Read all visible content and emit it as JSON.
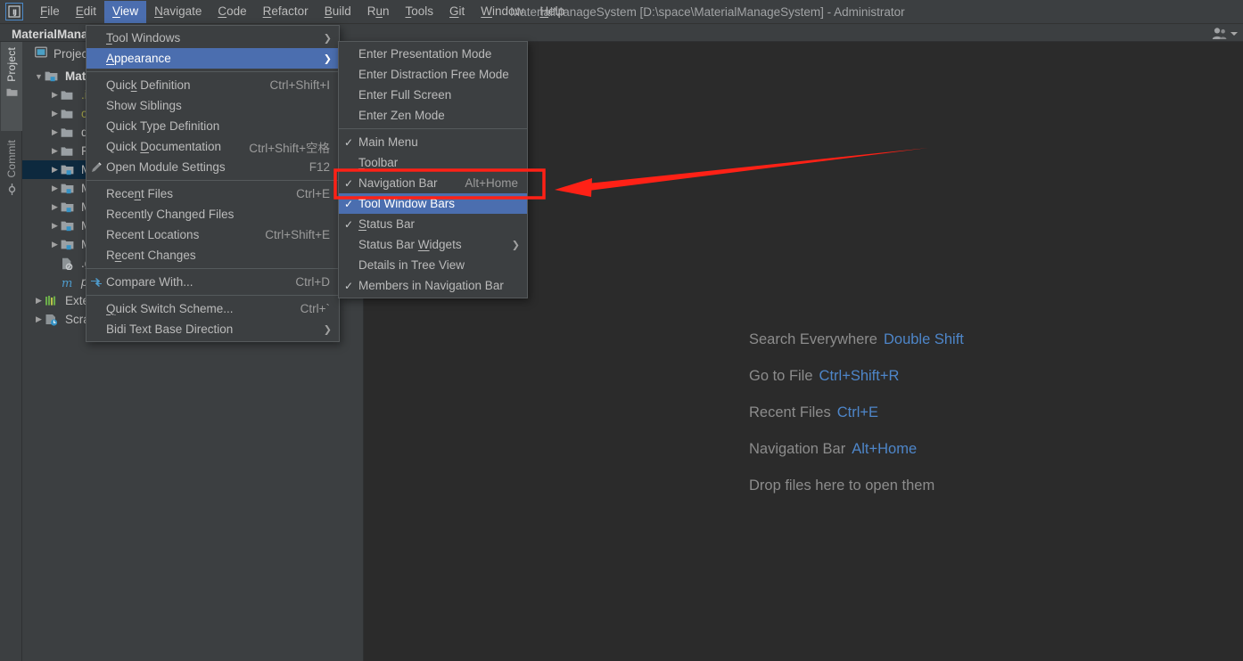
{
  "window": {
    "title": "MaterialManageSystem [D:\\space\\MaterialManageSystem] - Administrator",
    "logo_text": "IJ"
  },
  "menubar": {
    "items": [
      {
        "label": "File",
        "mnemonic": "F",
        "active": false
      },
      {
        "label": "Edit",
        "mnemonic": "E",
        "active": false
      },
      {
        "label": "View",
        "mnemonic": "V",
        "active": true
      },
      {
        "label": "Navigate",
        "mnemonic": "N",
        "active": false
      },
      {
        "label": "Code",
        "mnemonic": "C",
        "active": false
      },
      {
        "label": "Refactor",
        "mnemonic": "R",
        "active": false
      },
      {
        "label": "Build",
        "mnemonic": "B",
        "active": false
      },
      {
        "label": "Run",
        "mnemonic": "u",
        "active": false
      },
      {
        "label": "Tools",
        "mnemonic": "T",
        "active": false
      },
      {
        "label": "Git",
        "mnemonic": "G",
        "active": false
      },
      {
        "label": "Window",
        "mnemonic": "W",
        "active": false
      },
      {
        "label": "Help",
        "mnemonic": "H",
        "active": false
      }
    ]
  },
  "navbar": {
    "project_label": "MaterialMana",
    "avatar_icon": "user-account-icon",
    "avatar_caret_icon": "chevron-down-icon"
  },
  "tool_window_bar": {
    "buttons": [
      {
        "label": "Project",
        "icon": "folder-icon",
        "selected": true
      },
      {
        "label": "Commit",
        "icon": "commit-icon",
        "selected": false
      }
    ]
  },
  "project_pane": {
    "header": "Project",
    "header_icon": "project-view-icon",
    "tree": [
      {
        "indent": 0,
        "arrow": "down",
        "icon": "module-folder-icon",
        "label": "Mate",
        "style": "bold",
        "selected": false
      },
      {
        "indent": 1,
        "arrow": "right",
        "icon": "folder-icon",
        "label": ".id",
        "style": "yellowish",
        "selected": false
      },
      {
        "indent": 1,
        "arrow": "right",
        "icon": "folder-icon",
        "label": "ca",
        "style": "yellowish",
        "selected": false
      },
      {
        "indent": 1,
        "arrow": "right",
        "icon": "folder-icon",
        "label": "do",
        "style": "normal",
        "selected": false
      },
      {
        "indent": 1,
        "arrow": "right",
        "icon": "folder-icon",
        "label": "Fr",
        "style": "normal",
        "selected": false
      },
      {
        "indent": 1,
        "arrow": "right",
        "icon": "module-folder-icon",
        "label": "M",
        "style": "normal",
        "selected": true
      },
      {
        "indent": 1,
        "arrow": "right",
        "icon": "module-folder-icon",
        "label": "M",
        "style": "normal",
        "selected": false
      },
      {
        "indent": 1,
        "arrow": "right",
        "icon": "module-folder-icon",
        "label": "M",
        "style": "normal",
        "selected": false
      },
      {
        "indent": 1,
        "arrow": "right",
        "icon": "module-folder-icon",
        "label": "M",
        "style": "normal",
        "selected": false
      },
      {
        "indent": 1,
        "arrow": "right",
        "icon": "module-folder-icon",
        "label": "M",
        "style": "normal",
        "selected": false
      },
      {
        "indent": 1,
        "arrow": "none",
        "icon": "gitignore-file-icon",
        "label": ".g",
        "style": "normal",
        "selected": false
      },
      {
        "indent": 1,
        "arrow": "none",
        "icon": "maven-pom-icon",
        "label": "po",
        "style": "italic",
        "selected": false
      },
      {
        "indent": 0,
        "arrow": "right",
        "icon": "libraries-icon",
        "label": "Exter",
        "style": "normal",
        "selected": false
      },
      {
        "indent": 0,
        "arrow": "right",
        "icon": "scratches-icon",
        "label": "Scratches and Consoles",
        "style": "normal",
        "selected": false
      }
    ]
  },
  "view_menu": {
    "items": [
      {
        "label": "Tool Windows",
        "mnemonic": "T",
        "shortcut": "",
        "submenu": true,
        "check": false,
        "icon": "",
        "highlight": false
      },
      {
        "label": "Appearance",
        "mnemonic": "A",
        "shortcut": "",
        "submenu": true,
        "check": false,
        "icon": "",
        "highlight": true
      },
      {
        "separator": true
      },
      {
        "label": "Quick Definition",
        "mnemonic": "k",
        "shortcut": "Ctrl+Shift+I",
        "submenu": false,
        "check": false,
        "icon": "",
        "highlight": false
      },
      {
        "label": "Show Siblings",
        "mnemonic": "",
        "shortcut": "",
        "submenu": false,
        "check": false,
        "icon": "",
        "highlight": false
      },
      {
        "label": "Quick Type Definition",
        "mnemonic": "",
        "shortcut": "",
        "submenu": false,
        "check": false,
        "icon": "",
        "highlight": false
      },
      {
        "label": "Quick Documentation",
        "mnemonic": "D",
        "shortcut": "Ctrl+Shift+空格",
        "submenu": false,
        "check": false,
        "icon": "",
        "highlight": false
      },
      {
        "label": "Open Module Settings",
        "mnemonic": "",
        "shortcut": "F12",
        "submenu": false,
        "check": false,
        "icon": "pencil-icon",
        "highlight": false
      },
      {
        "separator": true
      },
      {
        "label": "Recent Files",
        "mnemonic": "n",
        "shortcut": "Ctrl+E",
        "submenu": false,
        "check": false,
        "icon": "",
        "highlight": false
      },
      {
        "label": "Recently Changed Files",
        "mnemonic": "",
        "shortcut": "",
        "submenu": false,
        "check": false,
        "icon": "",
        "highlight": false
      },
      {
        "label": "Recent Locations",
        "mnemonic": "",
        "shortcut": "Ctrl+Shift+E",
        "submenu": false,
        "check": false,
        "icon": "",
        "highlight": false
      },
      {
        "label": "Recent Changes",
        "mnemonic": "e",
        "shortcut": "",
        "submenu": false,
        "check": false,
        "icon": "",
        "highlight": false
      },
      {
        "separator": true
      },
      {
        "label": "Compare With...",
        "mnemonic": "",
        "shortcut": "Ctrl+D",
        "submenu": false,
        "check": false,
        "icon": "compare-icon",
        "highlight": false
      },
      {
        "separator": true
      },
      {
        "label": "Quick Switch Scheme...",
        "mnemonic": "Q",
        "shortcut": "Ctrl+`",
        "submenu": false,
        "check": false,
        "icon": "",
        "highlight": false
      },
      {
        "label": "Bidi Text Base Direction",
        "mnemonic": "",
        "shortcut": "",
        "submenu": true,
        "check": false,
        "icon": "",
        "highlight": false
      }
    ]
  },
  "appearance_menu": {
    "items": [
      {
        "label": "Enter Presentation Mode",
        "shortcut": "",
        "submenu": false,
        "check": false,
        "highlight": false
      },
      {
        "label": "Enter Distraction Free Mode",
        "shortcut": "",
        "submenu": false,
        "check": false,
        "highlight": false
      },
      {
        "label": "Enter Full Screen",
        "shortcut": "",
        "submenu": false,
        "check": false,
        "highlight": false
      },
      {
        "label": "Enter Zen Mode",
        "shortcut": "",
        "submenu": false,
        "check": false,
        "highlight": false
      },
      {
        "separator": true
      },
      {
        "label": "Main Menu",
        "shortcut": "",
        "submenu": false,
        "check": true,
        "highlight": false
      },
      {
        "label": "Toolbar",
        "shortcut": "",
        "submenu": false,
        "check": false,
        "highlight": false,
        "mnemonic": "T"
      },
      {
        "label": "Navigation Bar",
        "shortcut": "Alt+Home",
        "submenu": false,
        "check": true,
        "highlight": false
      },
      {
        "label": "Tool Window Bars",
        "shortcut": "",
        "submenu": false,
        "check": true,
        "highlight": true
      },
      {
        "label": "Status Bar",
        "shortcut": "",
        "submenu": false,
        "check": true,
        "highlight": false,
        "mnemonic": "S"
      },
      {
        "label": "Status Bar Widgets",
        "shortcut": "",
        "submenu": true,
        "check": false,
        "highlight": false,
        "mnemonic": "W"
      },
      {
        "label": "Details in Tree View",
        "shortcut": "",
        "submenu": false,
        "check": false,
        "highlight": false
      },
      {
        "label": "Members in Navigation Bar",
        "shortcut": "",
        "submenu": false,
        "check": true,
        "highlight": false
      }
    ]
  },
  "editor_hints": [
    {
      "label": "Search Everywhere",
      "key": "Double Shift"
    },
    {
      "label": "Go to File",
      "key": "Ctrl+Shift+R"
    },
    {
      "label": "Recent Files",
      "key": "Ctrl+E"
    },
    {
      "label": "Navigation Bar",
      "key": "Alt+Home"
    },
    {
      "label": "Drop files here to open them",
      "key": ""
    }
  ],
  "annotation": {
    "highlight_color": "#ff2116",
    "arrow_icon": "arrow-pointing-left",
    "target": "Tool Window Bars"
  },
  "colors": {
    "menu_highlight": "#4b6eaf",
    "panel_bg": "#3c3f41",
    "editor_bg": "#2b2b2b",
    "accent_blue": "#4e86c9",
    "tree_selection": "#0d293e",
    "annotation_red": "#ff2116"
  }
}
